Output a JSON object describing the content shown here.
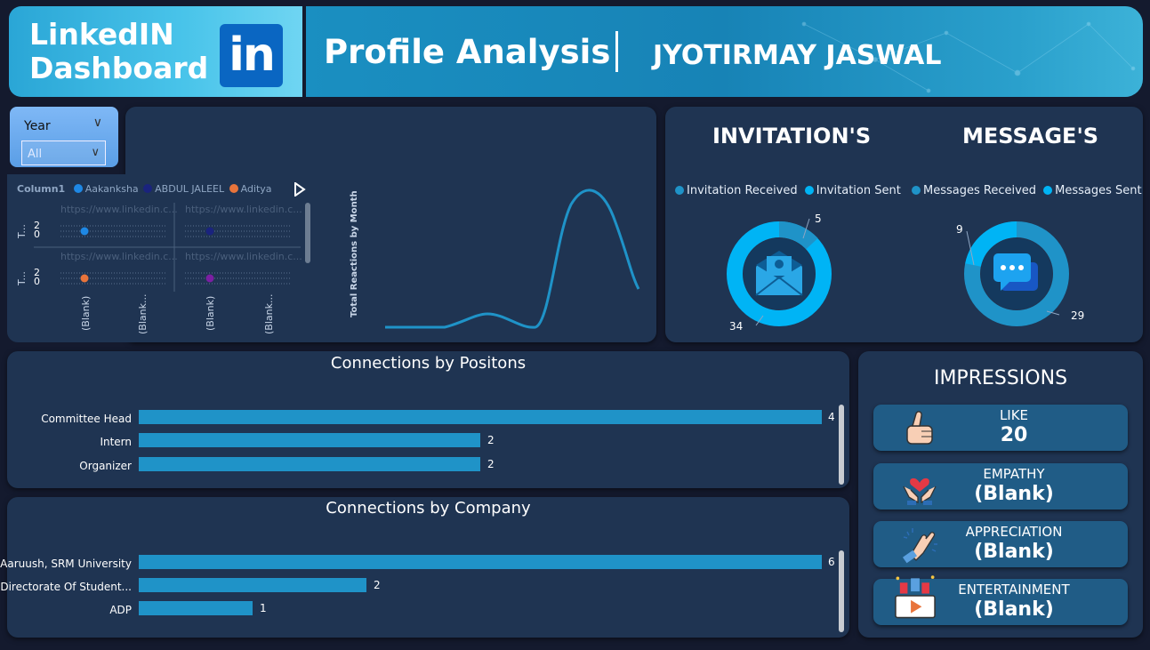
{
  "header": {
    "title_line1": "LinkedIN",
    "title_line2": "Dashboard",
    "logo_text": "in",
    "subtitle": "Profile Analysis",
    "name": "JYOTIRMAY JASWAL"
  },
  "slicer": {
    "label": "Year",
    "value": "All"
  },
  "scatter_panel": {
    "legend_title": "Column1",
    "legend": [
      {
        "name": "Aakanksha",
        "color": "#1e88e5"
      },
      {
        "name": "ABDUL JALEEL",
        "color": "#1a237e"
      },
      {
        "name": "Aditya",
        "color": "#e8743b"
      }
    ],
    "row_label": "T...",
    "tick_high": "2",
    "tick_low": "0",
    "url_label": "https://www.linkedin.c...",
    "x_labels": [
      "(Blank)",
      "(Blank...",
      "(Blank)",
      "(Blank..."
    ]
  },
  "line_panel": {
    "ylabel": "Total Reactions by Month"
  },
  "invitations": {
    "title": "INVITATION'S",
    "legend": [
      "Invitation Received",
      "Invitation Sent"
    ],
    "values": {
      "received": 34,
      "sent": 5
    },
    "label_small": "5",
    "label_large": "34"
  },
  "messages": {
    "title": "MESSAGE'S",
    "legend": [
      "Messages Received",
      "Messages Sent"
    ],
    "values": {
      "received": 29,
      "sent": 9
    },
    "label_small": "9",
    "label_large": "29"
  },
  "positions": {
    "title": "Connections by Positons",
    "items": [
      {
        "label": "Committee Head",
        "value": "4"
      },
      {
        "label": "Intern",
        "value": "2"
      },
      {
        "label": "Organizer",
        "value": "2"
      }
    ]
  },
  "companies": {
    "title": "Connections by Company",
    "items": [
      {
        "label": "Aaruush, SRM University",
        "value": "6"
      },
      {
        "label": "Directorate Of Student...",
        "value": "2"
      },
      {
        "label": "ADP",
        "value": "1"
      }
    ]
  },
  "impressions": {
    "title": "IMPRESSIONS",
    "cards": [
      {
        "label": "LIKE",
        "value": "20",
        "icon": "thumbs-up-icon"
      },
      {
        "label": "EMPATHY",
        "value": "(Blank)",
        "icon": "heart-hands-icon"
      },
      {
        "label": "APPRECIATION",
        "value": "(Blank)",
        "icon": "clapping-hands-icon"
      },
      {
        "label": "ENTERTAINMENT",
        "value": "(Blank)",
        "icon": "video-play-icon"
      }
    ]
  },
  "colors": {
    "accent": "#00b4f5",
    "accent_dark": "#1f93c8",
    "panel": "#1f3452"
  }
}
